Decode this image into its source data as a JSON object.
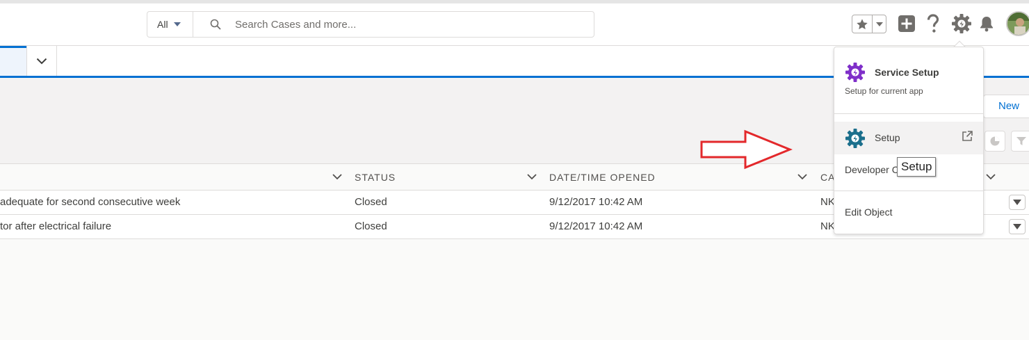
{
  "header": {
    "search_scope": "All",
    "search_placeholder": "Search Cases and more..."
  },
  "icons": {
    "favorites": "star-icon",
    "global_actions": "plus-icon",
    "help": "question-icon",
    "setup": "gear-icon",
    "notifications": "bell-icon",
    "user": "avatar"
  },
  "list_view": {
    "new_button": "New"
  },
  "table": {
    "columns": [
      "STATUS",
      "DATE/TIME OPENED",
      "CA"
    ],
    "rows": [
      {
        "subject": "adequate for second consecutive week",
        "status": "Closed",
        "opened": "9/12/2017 10:42 AM",
        "account": "NK"
      },
      {
        "subject": "tor after electrical failure",
        "status": "Closed",
        "opened": "9/12/2017 10:42 AM",
        "account": "NK"
      }
    ]
  },
  "setup_menu": {
    "service_setup_title": "Service Setup",
    "service_setup_subtitle": "Setup for current app",
    "setup_label": "Setup",
    "developer_label": "Developer C",
    "edit_object_label": "Edit Object",
    "tooltip": "Setup"
  },
  "colors": {
    "brand_blue": "#0070d2",
    "service_purple": "#7f2fc9",
    "setup_teal": "#1b6f8c",
    "annotation_red": "#e3282b"
  }
}
